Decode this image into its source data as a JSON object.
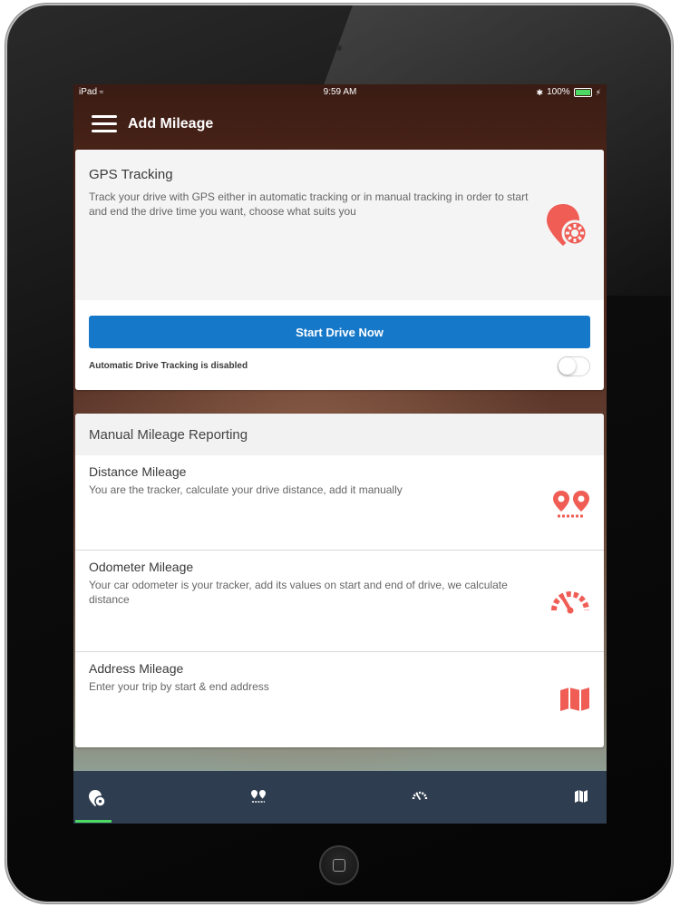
{
  "status_bar": {
    "device": "iPad",
    "time": "9:59 AM",
    "battery": "100%"
  },
  "app_bar": {
    "title": "Add Mileage"
  },
  "gps_card": {
    "title": "GPS Tracking",
    "description": "Track your drive with GPS either in automatic tracking or in manual tracking in order to start and end the drive time you want, choose what suits you",
    "start_button": "Start Drive Now",
    "auto_tracking_label": "Automatic Drive Tracking is disabled",
    "auto_tracking_enabled": false
  },
  "manual_card": {
    "title": "Manual Mileage Reporting",
    "rows": [
      {
        "title": "Distance Mileage",
        "description": "You are the tracker, calculate your drive distance, add it manually",
        "icon": "pins-distance-icon"
      },
      {
        "title": "Odometer Mileage",
        "description": "Your car odometer is your tracker, add its values on start and end of drive, we calculate distance",
        "icon": "odometer-icon"
      },
      {
        "title": "Address Mileage",
        "description": "Enter your trip by start & end address",
        "icon": "map-icon"
      }
    ]
  },
  "tab_bar": {
    "tabs": [
      {
        "icon": "gps-pin-icon",
        "active": true
      },
      {
        "icon": "pins-distance-icon",
        "active": false
      },
      {
        "icon": "odometer-icon",
        "active": false
      },
      {
        "icon": "map-icon",
        "active": false
      }
    ]
  },
  "colors": {
    "accent": "#1578c9",
    "icon": "#ef5d55",
    "tab_bar": "#2e3d4f",
    "active_tab": "#4cd964"
  }
}
